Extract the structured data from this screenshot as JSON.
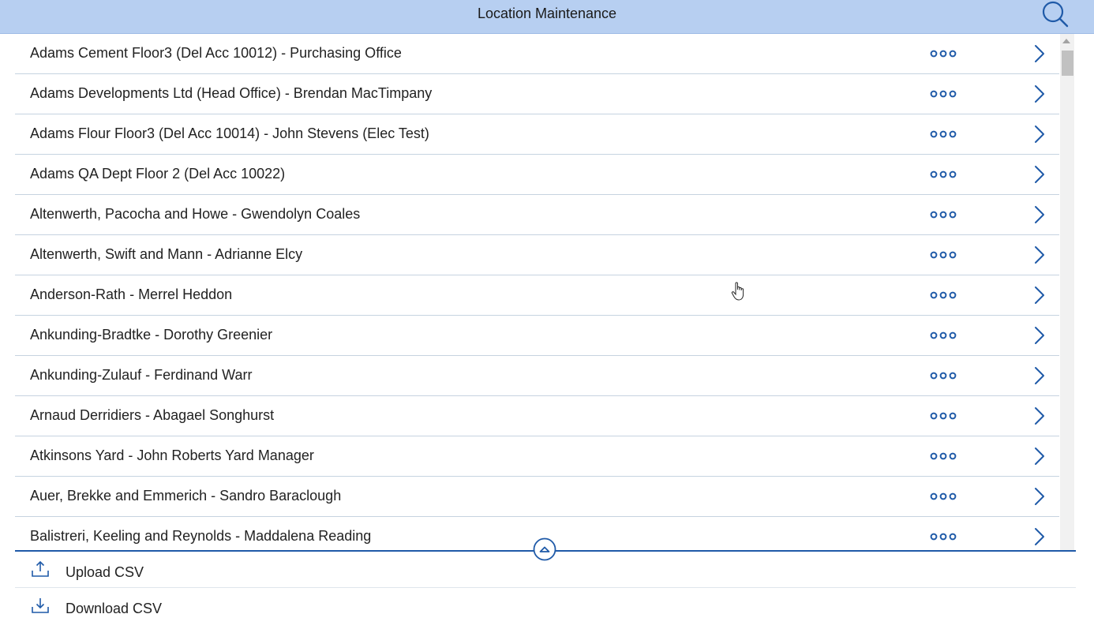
{
  "header": {
    "title": "Location Maintenance",
    "search_icon": "search-icon",
    "background": "#b7cff1"
  },
  "list": {
    "items": [
      {
        "label": "Adams Cement Floor3 (Del Acc 10012) - Purchasing Office"
      },
      {
        "label": "Adams Developments Ltd (Head Office) - Brendan MacTimpany"
      },
      {
        "label": "Adams Flour Floor3 (Del Acc 10014) - John Stevens (Elec Test)"
      },
      {
        "label": "Adams QA Dept Floor 2 (Del Acc 10022)"
      },
      {
        "label": "Altenwerth, Pacocha and Howe - Gwendolyn Coales"
      },
      {
        "label": "Altenwerth, Swift and Mann - Adrianne Elcy"
      },
      {
        "label": "Anderson-Rath - Merrel Heddon"
      },
      {
        "label": "Ankunding-Bradtke - Dorothy Greenier"
      },
      {
        "label": "Ankunding-Zulauf - Ferdinand Warr"
      },
      {
        "label": "Arnaud Derridiers - Abagael Songhurst"
      },
      {
        "label": "Atkinsons Yard - John Roberts Yard Manager"
      },
      {
        "label": "Auer, Brekke and Emmerich - Sandro Baraclough"
      },
      {
        "label": "Balistreri, Keeling and Reynolds - Maddalena Reading"
      }
    ],
    "more_icon": "more-dots-icon",
    "chevron_icon": "chevron-right-icon",
    "accent": "#1f5aa8"
  },
  "footer": {
    "collapse_icon": "chevron-up-circle-icon",
    "actions": [
      {
        "label": "Upload CSV",
        "icon": "upload-icon"
      },
      {
        "label": "Download CSV",
        "icon": "download-icon"
      }
    ]
  }
}
